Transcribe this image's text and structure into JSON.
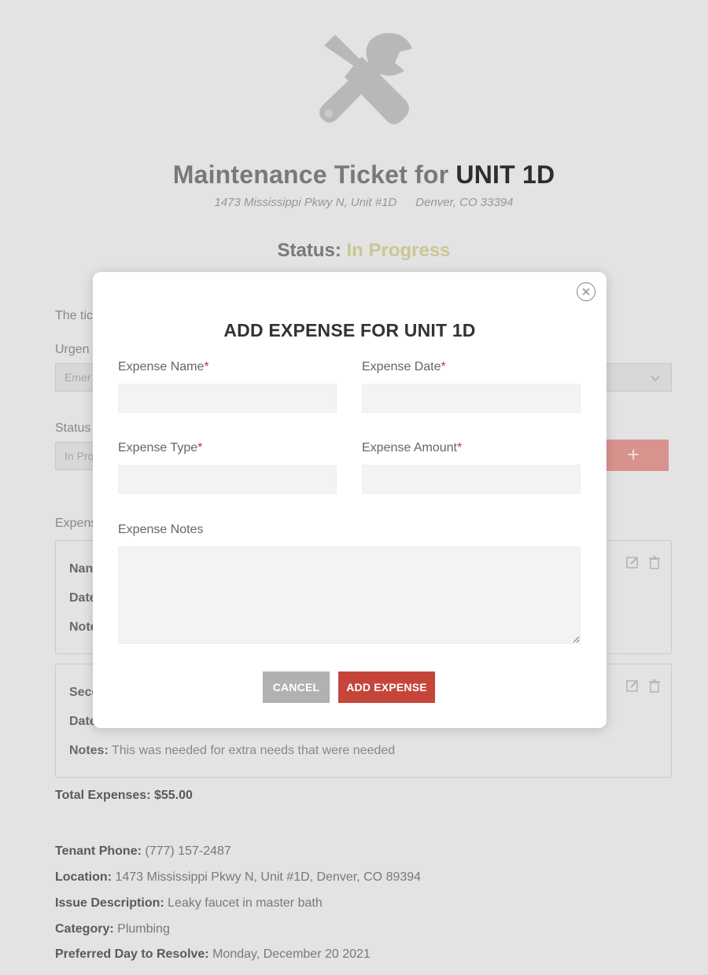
{
  "ticket": {
    "title_prefix": "Maintenance Ticket for",
    "unit": "UNIT 1D",
    "address_street": "1473 Mississippi Pkwy N, Unit #1D",
    "address_city": "Denver, CO 33394",
    "status_label": "Status:",
    "status_value": "In Progress",
    "ticket_text_partial": "The tic",
    "urgency_label_partial": "Urgen",
    "urgency_value_partial": "Emer",
    "status_field_label": "Status",
    "status_field_value_partial": "In Pro",
    "add_icon": "+",
    "expenses_label_partial": "Expens"
  },
  "expense_cards": [
    {
      "name_label_partial": "Nan",
      "date_label_partial": "Date",
      "notes_label_partial": "Note"
    },
    {
      "name_label_partial": "Seco",
      "date_label_partial": "Date",
      "notes_label": "Notes:",
      "notes_value": "This was needed for extra needs that were needed"
    }
  ],
  "total_expenses": {
    "label": "Total Expenses:",
    "value": "$55.00"
  },
  "tenant_info": [
    {
      "label": "Tenant Phone:",
      "value": "(777) 157-2487"
    },
    {
      "label": "Location:",
      "value": "1473 Mississippi Pkwy N, Unit #1D, Denver, CO 89394"
    },
    {
      "label": "Issue Description:",
      "value": "Leaky faucet in master bath"
    },
    {
      "label": "Category:",
      "value": "Plumbing"
    },
    {
      "label": "Preferred Day to Resolve:",
      "value": "Monday, December 20 2021"
    }
  ],
  "modal": {
    "title": "ADD EXPENSE FOR UNIT 1D",
    "fields": {
      "name": {
        "label": "Expense Name",
        "required": "*",
        "value": ""
      },
      "date": {
        "label": "Expense Date",
        "required": "*",
        "value": ""
      },
      "type": {
        "label": "Expense Type",
        "required": "*",
        "value": ""
      },
      "amount": {
        "label": "Expense Amount",
        "required": "*",
        "value": ""
      },
      "notes": {
        "label": "Expense Notes",
        "value": ""
      }
    },
    "cancel_label": "CANCEL",
    "add_label": "ADD EXPENSE",
    "close_icon": "close-circle-icon"
  },
  "colors": {
    "accent_red": "#c5453b",
    "cancel_grey": "#b1b1b1",
    "required_red": "#c0392b",
    "status_in_progress": "#e4dfa8"
  },
  "icons": [
    "tools-wrench-screwdriver-icon",
    "edit-icon",
    "trash-icon",
    "close-circle-icon"
  ]
}
